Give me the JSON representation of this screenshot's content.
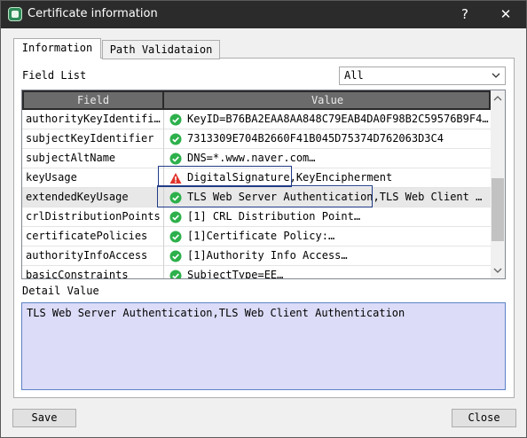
{
  "window": {
    "title": "Certificate information",
    "help_glyph": "?",
    "close_glyph": "✕"
  },
  "tabs": [
    {
      "label": "Information",
      "active": true
    },
    {
      "label": "Path Validataion",
      "active": false
    }
  ],
  "field_list": {
    "label": "Field List",
    "selected": "All"
  },
  "table": {
    "columns": [
      "Field",
      "Value"
    ],
    "rows": [
      {
        "field": "authorityKeyIdentifi…",
        "value": "KeyID=B76BA2EAA8AA848C79EAB4DA0F98B2C59576B9F4…",
        "status": "ok"
      },
      {
        "field": "subjectKeyIdentifier",
        "value": "7313309E704B2660F41B045D75374D762063D3C4",
        "status": "ok"
      },
      {
        "field": "subjectAltName",
        "value": "DNS=*.www.naver.com…",
        "status": "ok"
      },
      {
        "field": "keyUsage",
        "value": "DigitalSignature,KeyEncipherment",
        "status": "warning"
      },
      {
        "field": "extendedKeyUsage",
        "value": "TLS Web Server Authentication,TLS Web Client …",
        "status": "ok"
      },
      {
        "field": "crlDistributionPoints",
        "value": "[1] CRL Distribution Point…",
        "status": "ok"
      },
      {
        "field": "certificatePolicies",
        "value": "[1]Certificate Policy:…",
        "status": "ok"
      },
      {
        "field": "authorityInfoAccess",
        "value": "[1]Authority Info Access…",
        "status": "ok"
      },
      {
        "field": "basicConstraints",
        "value": "SubjectType=EE…",
        "status": "ok"
      }
    ]
  },
  "detail": {
    "label": "Detail Value",
    "text": "TLS Web Server Authentication,TLS Web Client Authentication"
  },
  "buttons": {
    "save": "Save",
    "close": "Close"
  },
  "colors": {
    "ok": "#2db04b",
    "warning": "#e0332b",
    "detail_bg": "#dcdcf8",
    "titlebar": "#2b2b2b"
  }
}
